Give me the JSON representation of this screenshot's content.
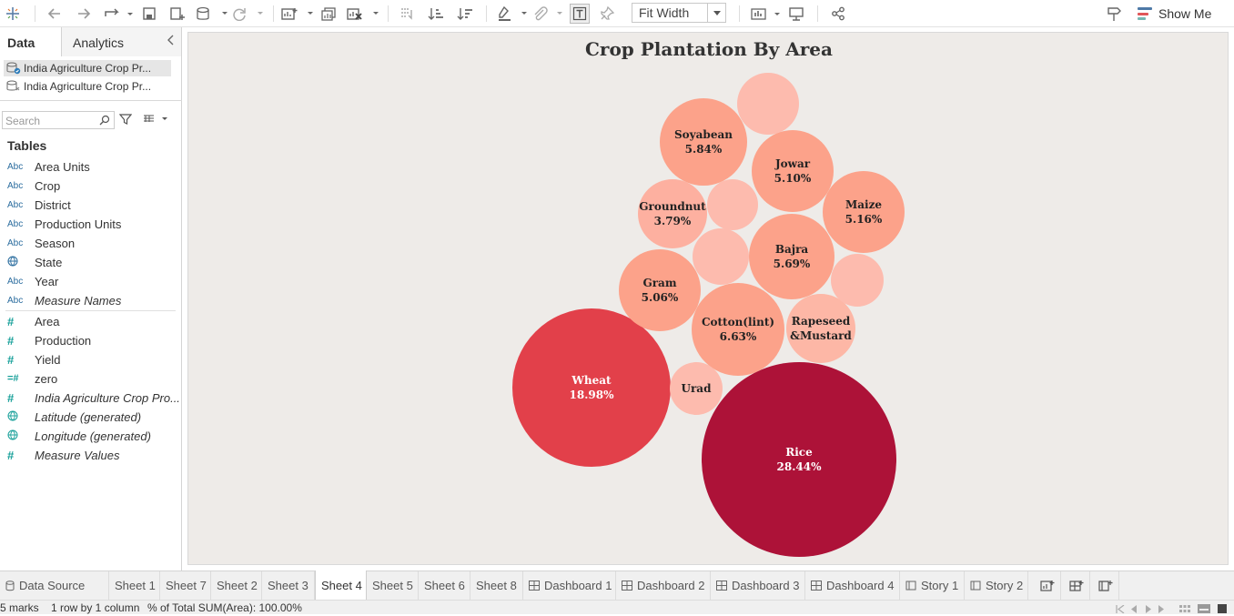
{
  "toolbar": {
    "fit_label": "Fit Width",
    "show_me_label": "Show Me",
    "show_me_colors": [
      "#4e79a7",
      "#e15759",
      "#76b7b2"
    ]
  },
  "pane": {
    "tab_data": "Data",
    "tab_analytics": "Analytics",
    "datasources": [
      "India Agriculture Crop Pr...",
      "India Agriculture Crop Pr..."
    ],
    "search_placeholder": "Search",
    "tables_heading": "Tables",
    "dimensions": [
      {
        "type": "Abc",
        "name": "Area Units"
      },
      {
        "type": "Abc",
        "name": "Crop"
      },
      {
        "type": "Abc",
        "name": "District"
      },
      {
        "type": "Abc",
        "name": "Production Units"
      },
      {
        "type": "Abc",
        "name": "Season"
      },
      {
        "type": "globe",
        "name": "State"
      },
      {
        "type": "Abc",
        "name": "Year"
      },
      {
        "type": "Abc",
        "name": "Measure Names"
      }
    ],
    "measures": [
      {
        "type": "#",
        "name": "Area"
      },
      {
        "type": "#",
        "name": "Production"
      },
      {
        "type": "#",
        "name": "Yield"
      },
      {
        "type": "=#",
        "name": "zero"
      },
      {
        "type": "#",
        "name": "India Agriculture Crop Pro..."
      },
      {
        "type": "globe",
        "name": "Latitude (generated)"
      },
      {
        "type": "globe",
        "name": "Longitude (generated)"
      },
      {
        "type": "#",
        "name": "Measure Values"
      }
    ]
  },
  "chart_data": {
    "type": "packed-bubble",
    "title": "Crop Plantation By Area",
    "measure": "% of Total SUM(Area)",
    "bubbles": [
      {
        "label": "Rice",
        "value_text": "28.44%",
        "value": 28.44,
        "color": "#ad1238",
        "text_color": "#ffffff"
      },
      {
        "label": "Wheat",
        "value_text": "18.98%",
        "value": 18.98,
        "color": "#e2404a",
        "text_color": "#ffffff"
      },
      {
        "label": "Cotton(lint)",
        "value_text": "6.63%",
        "value": 6.63,
        "color": "#fca28a",
        "text_color": "#222222"
      },
      {
        "label": "Soyabean",
        "value_text": "5.84%",
        "value": 5.84,
        "color": "#fca28a",
        "text_color": "#222222"
      },
      {
        "label": "Bajra",
        "value_text": "5.69%",
        "value": 5.69,
        "color": "#fca28a",
        "text_color": "#222222"
      },
      {
        "label": "Maize",
        "value_text": "5.16%",
        "value": 5.16,
        "color": "#fca28a",
        "text_color": "#222222"
      },
      {
        "label": "Jowar",
        "value_text": "5.10%",
        "value": 5.1,
        "color": "#fca28a",
        "text_color": "#222222"
      },
      {
        "label": "Gram",
        "value_text": "5.06%",
        "value": 5.06,
        "color": "#fca28a",
        "text_color": "#222222"
      },
      {
        "label": "Groundnut",
        "value_text": "3.79%",
        "value": 3.79,
        "color": "#fdb0a0",
        "text_color": "#222222"
      },
      {
        "label": "Rapeseed &Mustard",
        "value_text": "",
        "value": null,
        "color": "#fdb7a6",
        "text_color": "#222222"
      },
      {
        "label": "Urad",
        "value_text": "",
        "value": null,
        "color": "#fdbbae",
        "text_color": "#222222"
      },
      {
        "label": "",
        "value_text": "",
        "value": null,
        "color": "#fdbbae",
        "text_color": "#222222"
      },
      {
        "label": "",
        "value_text": "",
        "value": null,
        "color": "#fdbbae",
        "text_color": "#222222"
      },
      {
        "label": "",
        "value_text": "",
        "value": null,
        "color": "#fdbbae",
        "text_color": "#222222"
      },
      {
        "label": "",
        "value_text": "",
        "value": null,
        "color": "#fdbbae",
        "text_color": "#222222"
      }
    ]
  },
  "sheets": {
    "data_source": "Data Source",
    "tabs": [
      {
        "label": "Sheet 1",
        "kind": "sheet"
      },
      {
        "label": "Sheet 7",
        "kind": "sheet"
      },
      {
        "label": "Sheet 2",
        "kind": "sheet"
      },
      {
        "label": "Sheet 3",
        "kind": "sheet"
      },
      {
        "label": "Sheet 4",
        "kind": "sheet",
        "active": true
      },
      {
        "label": "Sheet 5",
        "kind": "sheet"
      },
      {
        "label": "Sheet 6",
        "kind": "sheet"
      },
      {
        "label": "Sheet 8",
        "kind": "sheet"
      },
      {
        "label": "Dashboard 1",
        "kind": "dashboard"
      },
      {
        "label": "Dashboard 2",
        "kind": "dashboard"
      },
      {
        "label": "Dashboard 3",
        "kind": "dashboard"
      },
      {
        "label": "Dashboard 4",
        "kind": "dashboard"
      },
      {
        "label": "Story 1",
        "kind": "story"
      },
      {
        "label": "Story 2",
        "kind": "story"
      }
    ]
  },
  "status": {
    "marks": "5 marks",
    "rows_cols": "1 row by 1 column",
    "summary": "% of Total SUM(Area): 100.00%"
  }
}
